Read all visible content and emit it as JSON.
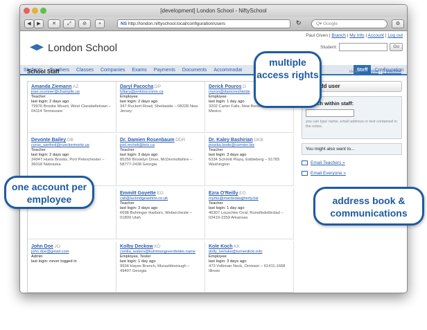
{
  "window": {
    "title": "[development] London School - NiftySchool"
  },
  "browser": {
    "url_prefix": "NS",
    "url": "http://london.niftyschool.local/configuration/users",
    "search_placeholder": "Google",
    "back": "◀",
    "forward": "▶",
    "add": "+"
  },
  "app": {
    "logo_text": "London School",
    "user_links": {
      "user": "Paul Given",
      "branch": "Branch",
      "my_info": "My Info",
      "account": "Account",
      "logout": "Log out"
    },
    "student_label": "Student:",
    "go_label": "Go",
    "nav": [
      "Students",
      "Teachers",
      "Classes",
      "Companies",
      "Exams",
      "Payments",
      "Documents",
      "Accommodat"
    ],
    "nav_right": [
      "Staff",
      "Configuration"
    ],
    "page_title": "School Staff",
    "view": {
      "label": "view:",
      "active": "23 active",
      "inactive": "0 inactive"
    }
  },
  "staff": [
    {
      "name": "Amanda Ziemann",
      "initials": "AZ",
      "email": "jose.oconner@champlin.us",
      "role": "Teacher",
      "login": "last login: 2 days ago",
      "address": "79976 Brooke Mount, West Clarabelletown – 04114 Tennessee"
    },
    {
      "name": "Daryl Pacocha",
      "initials": "DP",
      "email": "hillary@jenkinscronin.ca",
      "role": "Employee",
      "login": "last login: 2 days ago",
      "address": "347 Ruckert Road, Sheilaside – 08228 New Jersey"
    },
    {
      "name": "Derick Pouros",
      "initials": "D",
      "email": "myron@damoreshields",
      "role": "Employee",
      "login": "last login: 1 day ago",
      "address": "3202 Carter Falls, New Bennett – 42940 New Mexico"
    },
    {
      "name": "Devonte Bailey",
      "initials": "DB",
      "email": "cyrus_sanford@rueckermertz.us",
      "role": "Teacher",
      "login": "last login: 2 days ago",
      "address": "34947 Huels Brooks, Port Peterchester – 36018 Nebraska"
    },
    {
      "name": "Dr. Damien Rosenbaum",
      "initials": "DDR",
      "email": "joel.mcheli@kris.ca",
      "role": "Teacher",
      "login": "last login: 3 days ago",
      "address": "85256 Brooklyn Drive, McDermottshire – 58777-2438 Georgia"
    },
    {
      "name": "Dr. Kaley Bashirian",
      "initials": "DKB",
      "email": "jessika.bode@cormier.biz",
      "role": "Teacher",
      "login": "last login: 3 days ago",
      "address": "6334 Schmitt Plaza, Eddieberg – 91783 Washington"
    },
    {
      "name": "",
      "initials": "",
      "email": "",
      "role": "",
      "login": "",
      "address": "nberg – 77434-0628 Delaware"
    },
    {
      "name": "Emmitt Goyette",
      "initials": "EG",
      "email": "cali@luckridgeashire.co.uk",
      "role": "Teacher",
      "login": "last login: 3 days ago",
      "address": "6698 Bahringer Harbors, Webercheste – 01809 Utah"
    },
    {
      "name": "Ezra O'Reilly",
      "initials": "EO",
      "email": "myrtis@mantedaugherty.biz",
      "role": "Teacher",
      "login": "last login: 1 day ago",
      "address": "46307 Leuschke Oval, Runolfsdottirstad – 03419-2359 Arkansas"
    },
    {
      "name": "John Doe",
      "initials": "JO",
      "email": "john.doe@gmail.com",
      "role": "Admin",
      "login": "last login: never logged in",
      "address": ""
    },
    {
      "name": "Kolby Deckow",
      "initials": "KD",
      "email": "cordia_waters@kuhlmangreenfelder.name",
      "role": "Employee, Tester",
      "login": "last login: 1 day ago",
      "address": "9934 Hayes Branch, Murazikborough – 49407 Georgia"
    },
    {
      "name": "Kole Koch",
      "initials": "KK",
      "email": "dolly_kerluke@turnerdicki.info",
      "role": "Employee",
      "login": "last login: 3 days ago",
      "address": "473 Volkman Neck, Orntown – 61411-1668 Illinois"
    }
  ],
  "sidebar": {
    "add_user": "Add user",
    "search_title": "Search within staff:",
    "search_hint": "you can type name, email address or text contained in the notes.",
    "want_to": "You might also want to...",
    "email_teachers": "Email Teachers »",
    "email_everyone": "Email Everyone »"
  },
  "callouts": {
    "access": "multiple access rights",
    "account": "one account per employee",
    "address": "address book & communications"
  },
  "colors": {
    "accent": "#2f6fb3",
    "callout": "#1e5aa0",
    "link": "#2a5db0"
  }
}
